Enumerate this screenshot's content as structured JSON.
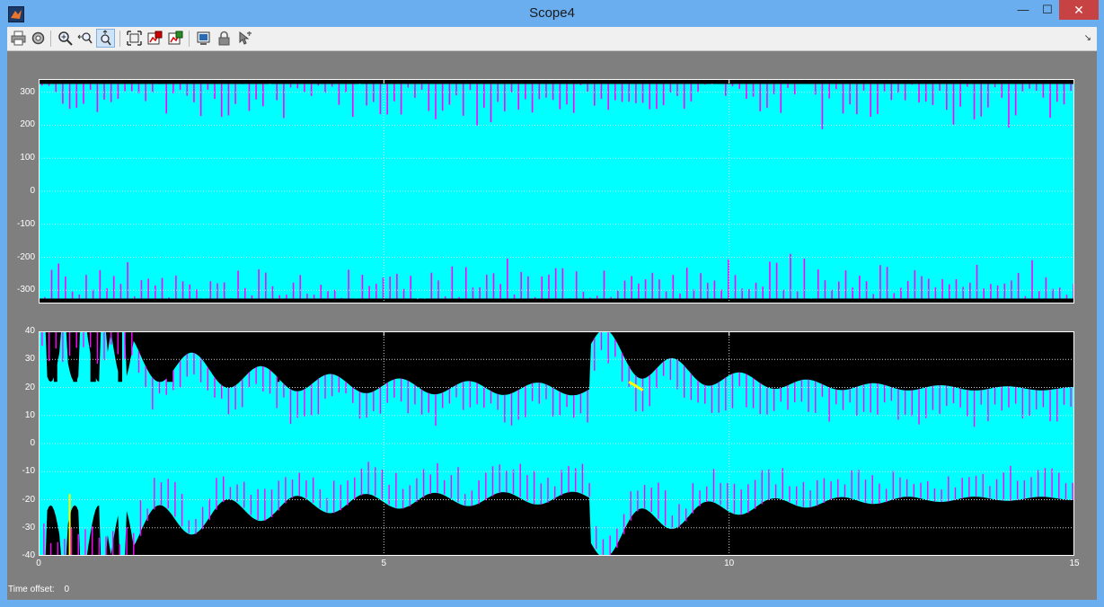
{
  "window": {
    "title": "Scope4",
    "minimize_glyph": "—",
    "maximize_glyph": "☐",
    "close_glyph": "✕"
  },
  "toolbar": {
    "buttons": [
      {
        "name": "print-icon"
      },
      {
        "name": "parameters-icon"
      },
      {
        "name": "zoom-icon"
      },
      {
        "name": "zoom-x-icon"
      },
      {
        "name": "zoom-y-icon",
        "active": true
      },
      {
        "name": "autoscale-icon"
      },
      {
        "name": "save-axes-icon"
      },
      {
        "name": "restore-axes-icon"
      },
      {
        "name": "floating-scope-icon"
      },
      {
        "name": "lock-axes-icon"
      },
      {
        "name": "signal-selection-icon"
      }
    ],
    "dock_glyph": "↘"
  },
  "chart_data": [
    {
      "type": "line",
      "series_colors": [
        "#ff00ff",
        "#00ffff",
        "#ffff00"
      ],
      "xlim": [
        0,
        15
      ],
      "ylim": [
        -340,
        340
      ],
      "x_ticks": [
        "0",
        "5",
        "10",
        "15"
      ],
      "y_ticks": [
        "300",
        "200",
        "100",
        "0",
        "-100",
        "-200",
        "-300"
      ],
      "y_tick_values": [
        300,
        200,
        100,
        0,
        -100,
        -200,
        -300
      ],
      "grid": true
    },
    {
      "type": "line",
      "series_colors": [
        "#ff00ff",
        "#00ffff",
        "#ffff00"
      ],
      "xlim": [
        0,
        15
      ],
      "ylim": [
        -40,
        40
      ],
      "x_ticks": [
        "0",
        "5",
        "10",
        "15"
      ],
      "x_tick_values": [
        0,
        5,
        10,
        15
      ],
      "y_ticks": [
        "40",
        "30",
        "20",
        "10",
        "0",
        "-10",
        "-20",
        "-30",
        "-40"
      ],
      "y_tick_values": [
        40,
        30,
        20,
        10,
        0,
        -10,
        -20,
        -30,
        -40
      ],
      "grid": true
    }
  ],
  "status": {
    "time_offset_label": "Time offset:",
    "time_offset_value": "0"
  }
}
